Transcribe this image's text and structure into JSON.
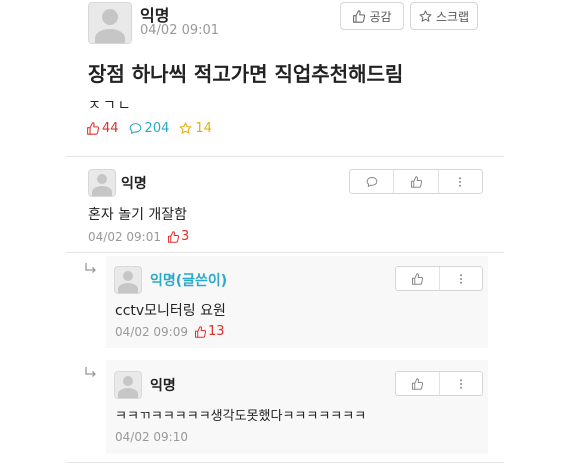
{
  "post": {
    "author": "익명",
    "time": "04/02 09:01",
    "like_label": "공감",
    "scrap_label": "스크랩",
    "title": "장점 하나씩 적고가면 직업추천해드림",
    "body": "ㅈㄱㄴ",
    "likes": "44",
    "comments": "204",
    "scraps": "14",
    "colors": {
      "like": "#e0312a",
      "comment": "#2aa9c9",
      "scrap": "#e8b00c"
    }
  },
  "comments": [
    {
      "author": "익명",
      "text": "혼자 놀기 개잘함",
      "time": "04/02 09:01",
      "likes": "3"
    }
  ],
  "replies": [
    {
      "author": "익명(글쓴이)",
      "text": "cctv모니터링 요원",
      "time": "04/02 09:09",
      "likes": "13",
      "author_color": "#2aa9c9"
    },
    {
      "author": "익명",
      "text": "ㅋㅋㄲㅋㅋㅋㅋㅋ생각도못했다ㅋㅋㅋㅋㅋㅋㅋ",
      "time": "04/02 09:10"
    }
  ]
}
